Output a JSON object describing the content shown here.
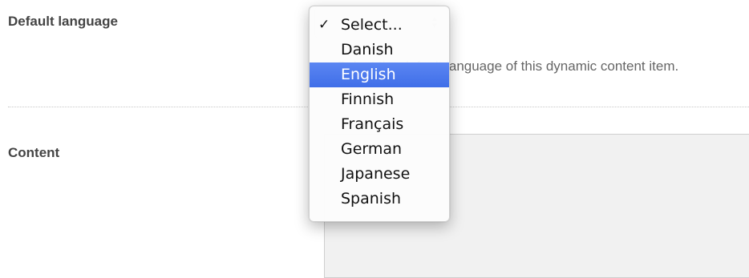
{
  "form": {
    "default_language_label": "Default language",
    "help_text": "Select the default language of this dynamic content item.",
    "content_label": "Content"
  },
  "language_select": {
    "selected_value": "Select...",
    "options": [
      {
        "label": "Select...",
        "checked": true,
        "highlighted": false
      },
      {
        "label": "Danish",
        "checked": false,
        "highlighted": false
      },
      {
        "label": "English",
        "checked": false,
        "highlighted": true
      },
      {
        "label": "Finnish",
        "checked": false,
        "highlighted": false
      },
      {
        "label": "Français",
        "checked": false,
        "highlighted": false
      },
      {
        "label": "German",
        "checked": false,
        "highlighted": false
      },
      {
        "label": "Japanese",
        "checked": false,
        "highlighted": false
      },
      {
        "label": "Spanish",
        "checked": false,
        "highlighted": false
      }
    ],
    "check_glyph": "✓",
    "highlight_color": "#4a78ee"
  }
}
